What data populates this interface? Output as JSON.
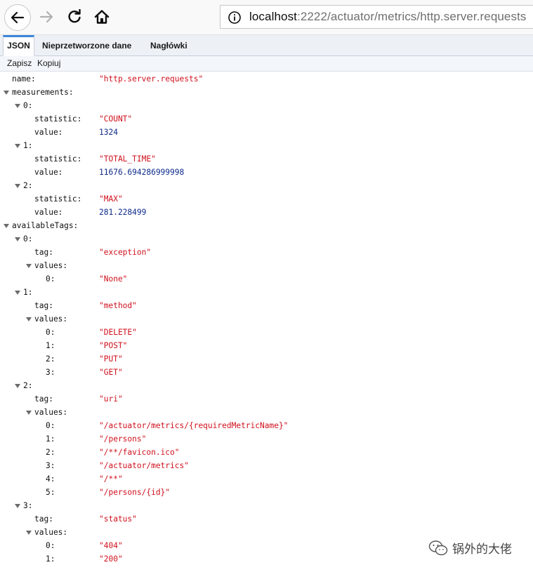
{
  "browser": {
    "url_host": "localhost",
    "url_path": ":2222/actuator/metrics/http.server.requests"
  },
  "tabs": [
    {
      "label": "JSON",
      "active": true
    },
    {
      "label": "Nieprzetworzone dane",
      "active": false
    },
    {
      "label": "Nagłówki",
      "active": false
    }
  ],
  "toolbar": {
    "save_label": "Zapisz",
    "copy_label": "Kopiuj"
  },
  "tree": [
    {
      "depth": 0,
      "key": "name:",
      "value": "\"http.server.requests\"",
      "type": "string",
      "expandable": false
    },
    {
      "depth": 0,
      "key": "measurements:",
      "value": "",
      "type": "none",
      "expandable": true
    },
    {
      "depth": 1,
      "key": "0:",
      "value": "",
      "type": "none",
      "expandable": true
    },
    {
      "depth": 2,
      "key": "statistic:",
      "value": "\"COUNT\"",
      "type": "string",
      "expandable": false
    },
    {
      "depth": 2,
      "key": "value:",
      "value": "1324",
      "type": "number",
      "expandable": false
    },
    {
      "depth": 1,
      "key": "1:",
      "value": "",
      "type": "none",
      "expandable": true
    },
    {
      "depth": 2,
      "key": "statistic:",
      "value": "\"TOTAL_TIME\"",
      "type": "string",
      "expandable": false
    },
    {
      "depth": 2,
      "key": "value:",
      "value": "11676.694286999998",
      "type": "number",
      "expandable": false
    },
    {
      "depth": 1,
      "key": "2:",
      "value": "",
      "type": "none",
      "expandable": true
    },
    {
      "depth": 2,
      "key": "statistic:",
      "value": "\"MAX\"",
      "type": "string",
      "expandable": false
    },
    {
      "depth": 2,
      "key": "value:",
      "value": "281.228499",
      "type": "number",
      "expandable": false
    },
    {
      "depth": 0,
      "key": "availableTags:",
      "value": "",
      "type": "none",
      "expandable": true
    },
    {
      "depth": 1,
      "key": "0:",
      "value": "",
      "type": "none",
      "expandable": true
    },
    {
      "depth": 2,
      "key": "tag:",
      "value": "\"exception\"",
      "type": "string",
      "expandable": false
    },
    {
      "depth": 2,
      "key": "values:",
      "value": "",
      "type": "none",
      "expandable": true
    },
    {
      "depth": 3,
      "key": "0:",
      "value": "\"None\"",
      "type": "string",
      "expandable": false
    },
    {
      "depth": 1,
      "key": "1:",
      "value": "",
      "type": "none",
      "expandable": true
    },
    {
      "depth": 2,
      "key": "tag:",
      "value": "\"method\"",
      "type": "string",
      "expandable": false
    },
    {
      "depth": 2,
      "key": "values:",
      "value": "",
      "type": "none",
      "expandable": true
    },
    {
      "depth": 3,
      "key": "0:",
      "value": "\"DELETE\"",
      "type": "string",
      "expandable": false
    },
    {
      "depth": 3,
      "key": "1:",
      "value": "\"POST\"",
      "type": "string",
      "expandable": false
    },
    {
      "depth": 3,
      "key": "2:",
      "value": "\"PUT\"",
      "type": "string",
      "expandable": false
    },
    {
      "depth": 3,
      "key": "3:",
      "value": "\"GET\"",
      "type": "string",
      "expandable": false
    },
    {
      "depth": 1,
      "key": "2:",
      "value": "",
      "type": "none",
      "expandable": true
    },
    {
      "depth": 2,
      "key": "tag:",
      "value": "\"uri\"",
      "type": "string",
      "expandable": false
    },
    {
      "depth": 2,
      "key": "values:",
      "value": "",
      "type": "none",
      "expandable": true
    },
    {
      "depth": 3,
      "key": "0:",
      "value": "\"/actuator/metrics/{requiredMetricName}\"",
      "type": "string",
      "expandable": false
    },
    {
      "depth": 3,
      "key": "1:",
      "value": "\"/persons\"",
      "type": "string",
      "expandable": false
    },
    {
      "depth": 3,
      "key": "2:",
      "value": "\"/**/favicon.ico\"",
      "type": "string",
      "expandable": false
    },
    {
      "depth": 3,
      "key": "3:",
      "value": "\"/actuator/metrics\"",
      "type": "string",
      "expandable": false
    },
    {
      "depth": 3,
      "key": "4:",
      "value": "\"/**\"",
      "type": "string",
      "expandable": false
    },
    {
      "depth": 3,
      "key": "5:",
      "value": "\"/persons/{id}\"",
      "type": "string",
      "expandable": false
    },
    {
      "depth": 1,
      "key": "3:",
      "value": "",
      "type": "none",
      "expandable": true
    },
    {
      "depth": 2,
      "key": "tag:",
      "value": "\"status\"",
      "type": "string",
      "expandable": false
    },
    {
      "depth": 2,
      "key": "values:",
      "value": "",
      "type": "none",
      "expandable": true
    },
    {
      "depth": 3,
      "key": "0:",
      "value": "\"404\"",
      "type": "string",
      "expandable": false
    },
    {
      "depth": 3,
      "key": "1:",
      "value": "\"200\"",
      "type": "string",
      "expandable": false
    }
  ],
  "watermark": {
    "text": "锅外的大佬",
    "icon": "wechat-icon"
  },
  "colors": {
    "string": "#d0101c",
    "number": "#0d2a8a",
    "tab_accent": "#3d86d8"
  }
}
